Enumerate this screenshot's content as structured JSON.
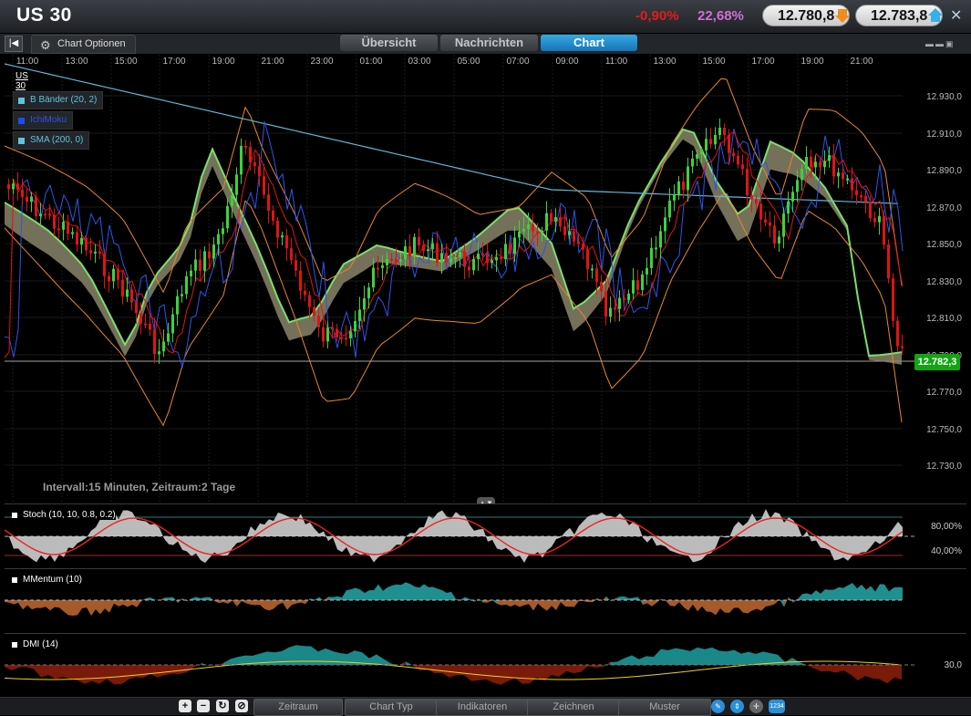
{
  "header": {
    "instrument": "US 30",
    "change_pct": "-0,90%",
    "spread_pct": "22,68%",
    "sell_price": "12.780,8",
    "buy_price": "12.783,8",
    "colors": {
      "negative": "#e01e1e",
      "spread": "#d16fd3",
      "sell_arrow": "#f08c1a",
      "buy_arrow": "#36b0e6"
    }
  },
  "toolbar": {
    "options_label": "Chart Optionen",
    "tabs": [
      {
        "label": "Übersicht",
        "active": false
      },
      {
        "label": "Nachrichten",
        "active": false
      },
      {
        "label": "Chart",
        "active": true
      }
    ]
  },
  "main_chart": {
    "time_labels": [
      "11:00",
      "13:00",
      "15:00",
      "17:00",
      "19:00",
      "21:00",
      "23:00",
      "01:00",
      "03:00",
      "05:00",
      "07:00",
      "09:00",
      "11:00",
      "13:00",
      "15:00",
      "17:00",
      "19:00",
      "21:00"
    ],
    "price_labels": [
      "12.930,0",
      "12.910,0",
      "12.890,0",
      "12.870,0",
      "12.850,0",
      "12.830,0",
      "12.810,0",
      "12.790,0",
      "12.770,0",
      "12.750,0",
      "12.730,0"
    ],
    "current_price": "12.782,3",
    "interval_text": "Intervall:15 Minuten, Zeitraum:2 Tage",
    "legend_title": "US 30",
    "legend": [
      {
        "label": "B Bänder (20, 2)",
        "color": "#5fc4d8"
      },
      {
        "label": "IchiMoku",
        "color": "#1d4df0"
      },
      {
        "label": "SMA (200, 0)",
        "color": "#5fc4d8"
      }
    ],
    "colors": {
      "up": "#3ed13e",
      "down": "#e01414",
      "bollinger": "#e8872e",
      "sma": "#60b9d6",
      "ichimoku": "#2d55e8",
      "kijun": "#e01414",
      "cloud": "#8a8468"
    }
  },
  "indicators": {
    "stoch": {
      "label": "Stoch (10, 10, 0.8, 0.2)",
      "levels": [
        "80,00%",
        "40,00%"
      ]
    },
    "momentum": {
      "label": "MMentum (10)"
    },
    "dmi": {
      "label": "DMI (14)",
      "level": "30,0"
    }
  },
  "bottom": {
    "tabs": [
      "Zeitraum",
      "Chart Typ",
      "Indikatoren",
      "Zeichnen",
      "Muster"
    ],
    "icons": [
      "zoom-in-icon",
      "zoom-out-icon",
      "refresh-icon",
      "disable-icon",
      "pencil-icon",
      "arrows-icon",
      "crosshair-icon",
      "price-tag-icon"
    ],
    "price_tag_text": "1234"
  }
}
